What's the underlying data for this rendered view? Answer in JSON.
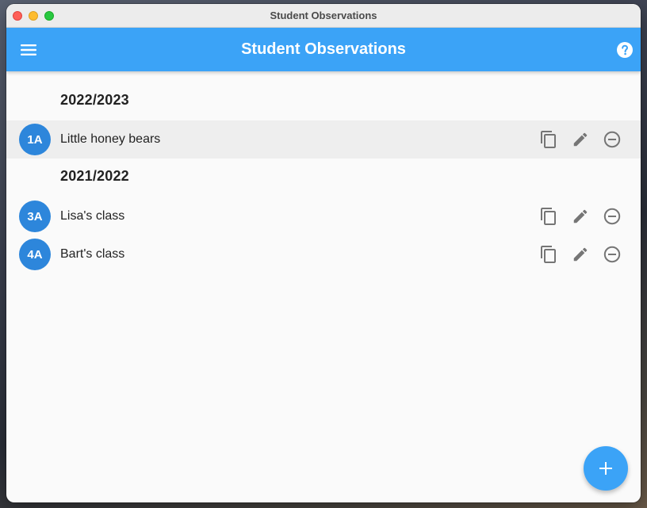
{
  "window": {
    "title": "Student Observations"
  },
  "appbar": {
    "title": "Student Observations",
    "menu_icon": "menu-icon",
    "help_icon": "help-icon"
  },
  "colors": {
    "primary": "#3ba3f7",
    "avatar": "#2d86db",
    "action_icon": "#757575"
  },
  "sections": [
    {
      "year": "2022/2023",
      "classes": [
        {
          "badge": "1A",
          "name": "Little honey bears"
        }
      ]
    },
    {
      "year": "2021/2022",
      "classes": [
        {
          "badge": "3A",
          "name": "Lisa's class"
        },
        {
          "badge": "4A",
          "name": "Bart's class"
        }
      ]
    }
  ],
  "row_actions": [
    "copy-icon",
    "edit-icon",
    "remove-icon"
  ],
  "fab": {
    "icon": "add-icon"
  }
}
